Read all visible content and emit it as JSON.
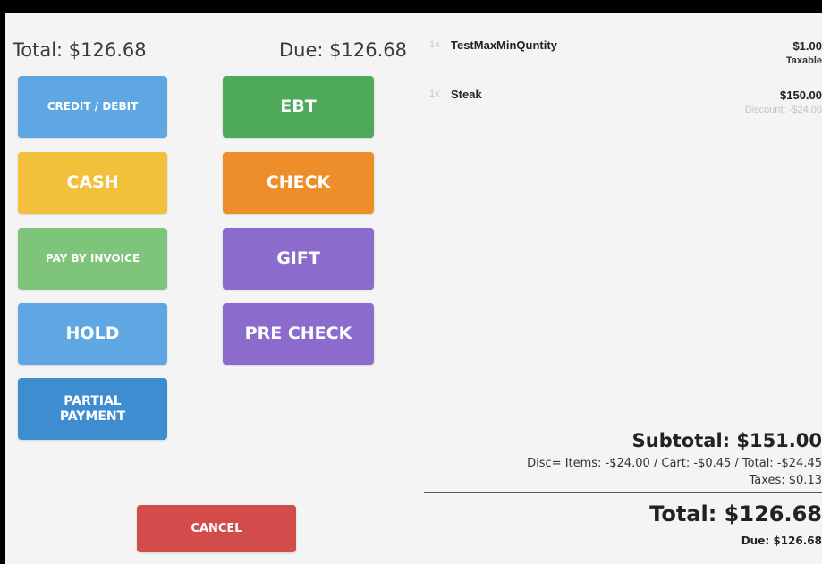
{
  "header": {
    "total": "Total: $126.68",
    "due": "Due: $126.68"
  },
  "payment_buttons": {
    "credit_debit": "CREDIT / DEBIT",
    "ebt": "EBT",
    "cash": "CASH",
    "check": "CHECK",
    "pay_by_invoice": "PAY BY INVOICE",
    "gift": "GIFT",
    "hold": "HOLD",
    "pre_check": "PRE CHECK",
    "partial_payment": "PARTIAL PAYMENT",
    "cancel": "CANCEL"
  },
  "items": [
    {
      "qty": "1x",
      "name": "TestMaxMinQuntity",
      "price": "$1.00",
      "note": "Taxable"
    },
    {
      "qty": "1x",
      "name": "Steak",
      "price": "$150.00",
      "note": "Discount: -$24.00"
    }
  ],
  "summary": {
    "subtotal": "Subtotal: $151.00",
    "discounts": "Disc= Items: -$24.00 / Cart: -$0.45 / Total: -$24.45",
    "taxes": "Taxes: $0.13",
    "total": "Total: $126.68",
    "due": "Due: $126.68"
  },
  "colors": {
    "credit_debit": "#5ea7e2",
    "ebt": "#4fa95a",
    "cash": "#f3c03b",
    "check": "#ee8e2a",
    "pay_by_invoice": "#7fc47b",
    "gift": "#8b6ccd",
    "hold": "#5ea7e2",
    "pre_check": "#8b6ccd",
    "partial_payment": "#3f8dd1",
    "cancel": "#d24c4b"
  }
}
